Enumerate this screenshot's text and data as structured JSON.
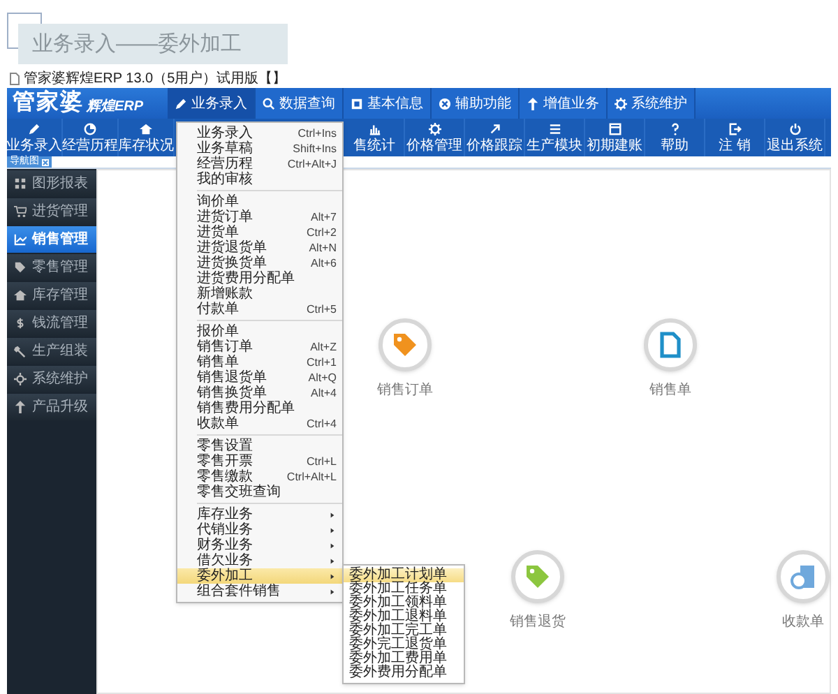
{
  "slide_title": "业务录入——委外加工",
  "window_title": "管家婆辉煌ERP 13.0（5用户）试用版【】",
  "logo": {
    "main": "管家婆",
    "sub": "辉煌ERP"
  },
  "nav": [
    {
      "label": "业务录入",
      "selected": true
    },
    {
      "label": "数据查询",
      "selected": false
    },
    {
      "label": "基本信息",
      "selected": false
    },
    {
      "label": "辅助功能",
      "selected": false
    },
    {
      "label": "增值业务",
      "selected": false
    },
    {
      "label": "系统维护",
      "selected": false
    }
  ],
  "toolbar_left": [
    "业务录入",
    "经营历程",
    "库存状况"
  ],
  "toolbar_right": [
    "售统计",
    "价格管理",
    "价格跟踪",
    "生产模块",
    "初期建账",
    "帮助",
    "注 销",
    "退出系统"
  ],
  "tab": {
    "label": "导航图"
  },
  "sidebar": [
    {
      "label": "图形报表",
      "selected": false
    },
    {
      "label": "进货管理",
      "selected": false
    },
    {
      "label": "销售管理",
      "selected": true
    },
    {
      "label": "零售管理",
      "selected": false
    },
    {
      "label": "库存管理",
      "selected": false
    },
    {
      "label": "钱流管理",
      "selected": false
    },
    {
      "label": "生产组装",
      "selected": false
    },
    {
      "label": "系统维护",
      "selected": false
    },
    {
      "label": "产品升级",
      "selected": false
    }
  ],
  "menu": [
    [
      {
        "label": "业务录入",
        "shortcut": "Ctrl+Ins",
        "selected": false
      },
      {
        "label": "业务草稿",
        "shortcut": "Shift+Ins",
        "selected": false
      },
      {
        "label": "经营历程",
        "shortcut": "Ctrl+Alt+J",
        "selected": false
      },
      {
        "label": "我的审核",
        "selected": false
      }
    ],
    [
      {
        "label": "询价单",
        "selected": false
      },
      {
        "label": "进货订单",
        "shortcut": "Alt+7",
        "selected": false
      },
      {
        "label": "进货单",
        "shortcut": "Ctrl+2",
        "selected": false
      },
      {
        "label": "进货退货单",
        "shortcut": "Alt+N",
        "selected": false
      },
      {
        "label": "进货换货单",
        "shortcut": "Alt+6",
        "selected": false
      },
      {
        "label": "进货费用分配单",
        "selected": false
      },
      {
        "label": "新增账款",
        "selected": false
      },
      {
        "label": "付款单",
        "shortcut": "Ctrl+5",
        "selected": false
      }
    ],
    [
      {
        "label": "报价单",
        "selected": false
      },
      {
        "label": "销售订单",
        "shortcut": "Alt+Z",
        "selected": false
      },
      {
        "label": "销售单",
        "shortcut": "Ctrl+1",
        "selected": false
      },
      {
        "label": "销售退货单",
        "shortcut": "Alt+Q",
        "selected": false
      },
      {
        "label": "销售换货单",
        "shortcut": "Alt+4",
        "selected": false
      },
      {
        "label": "销售费用分配单",
        "selected": false
      },
      {
        "label": "收款单",
        "shortcut": "Ctrl+4",
        "selected": false
      }
    ],
    [
      {
        "label": "零售设置",
        "selected": false
      },
      {
        "label": "零售开票",
        "shortcut": "Ctrl+L",
        "selected": false
      },
      {
        "label": "零售缴款",
        "shortcut": "Ctrl+Alt+L",
        "selected": false
      },
      {
        "label": "零售交班查询",
        "selected": false
      }
    ],
    [
      {
        "label": "库存业务",
        "submenu": true,
        "selected": false
      },
      {
        "label": "代销业务",
        "submenu": true,
        "selected": false
      },
      {
        "label": "财务业务",
        "submenu": true,
        "selected": false
      },
      {
        "label": "借欠业务",
        "submenu": true,
        "selected": false
      },
      {
        "label": "委外加工",
        "submenu": true,
        "selected": true
      },
      {
        "label": "组合套件销售",
        "submenu": true,
        "selected": false
      }
    ]
  ],
  "submenu": [
    {
      "label": "委外加工计划单",
      "selected": true
    },
    {
      "label": "委外加工任务单",
      "selected": false
    },
    {
      "label": "委外加工领料单",
      "selected": false
    },
    {
      "label": "委外加工退料单",
      "selected": false
    },
    {
      "label": "委外加工完工单",
      "selected": false
    },
    {
      "label": "委外完工退货单",
      "selected": false
    },
    {
      "label": "委外加工费用单",
      "selected": false
    },
    {
      "label": "委外费用分配单",
      "selected": false
    }
  ],
  "nodes": [
    {
      "label": "销售订单",
      "color": "#f0921e"
    },
    {
      "label": "销售单",
      "color": "#1f8fc8"
    },
    {
      "label": "销售退货",
      "color": "#8cc63f"
    },
    {
      "label": "收款单",
      "color": "#6fa8dc"
    }
  ]
}
